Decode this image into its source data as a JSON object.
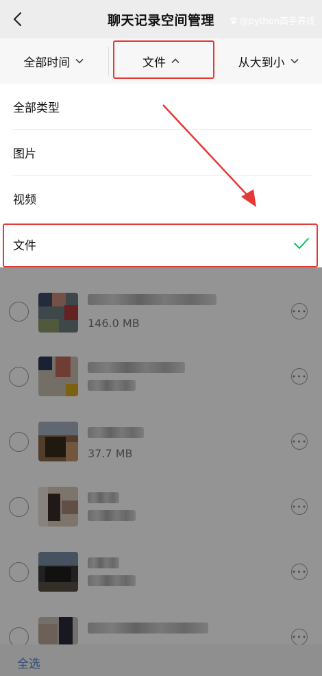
{
  "header": {
    "title": "聊天记录空间管理",
    "back_icon": "chevron-left-icon"
  },
  "filters": {
    "time": {
      "label": "全部时间",
      "icon": "chevron-down-icon"
    },
    "type": {
      "label": "文件",
      "icon": "chevron-up-icon"
    },
    "sort": {
      "label": "从大到小",
      "icon": "chevron-down-icon"
    }
  },
  "menu": {
    "items": [
      {
        "label": "全部类型"
      },
      {
        "label": "图片"
      },
      {
        "label": "视频"
      },
      {
        "label": "文件",
        "selected": true
      }
    ],
    "check_color": "#07c160"
  },
  "files": [
    {
      "size": "146.0 MB"
    },
    {
      "size": ""
    },
    {
      "size": "37.7 MB"
    },
    {
      "size": ""
    },
    {
      "size": ""
    },
    {
      "size": ""
    }
  ],
  "bottom": {
    "select_all": "全选"
  },
  "watermark": {
    "text": "@python高手养成"
  },
  "colors": {
    "highlight": "#e53935",
    "accent_link": "#4a7fd0"
  }
}
